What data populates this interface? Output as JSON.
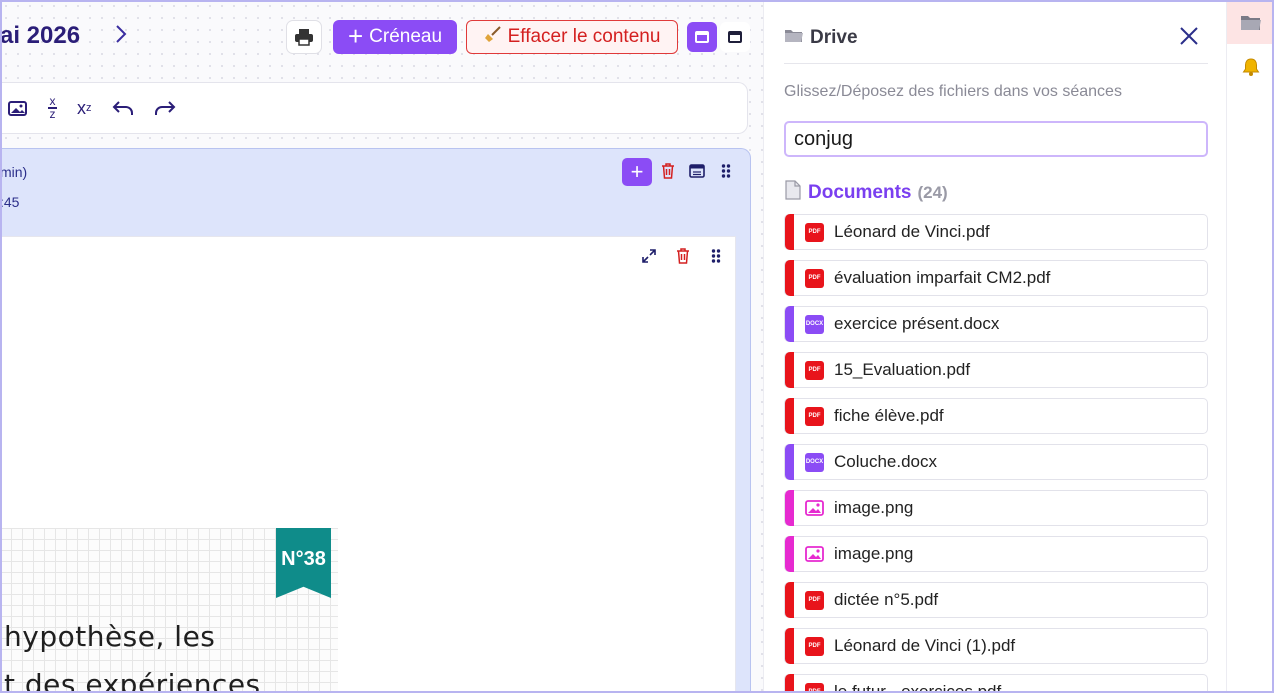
{
  "header": {
    "title": "ai 2026",
    "print_label": "",
    "add_slot_label": "Créneau",
    "clear_label": "Effacer le contenu"
  },
  "toolbar": {
    "fraction_top": "x",
    "fraction_bottom": "z",
    "superscript_base": "x",
    "superscript_exp": "z"
  },
  "session": {
    "duration": "min)",
    "time": ":45"
  },
  "document_preview": {
    "badge": "N°38",
    "line1": "hypothèse, les",
    "line2": "t des expériences"
  },
  "drive": {
    "title": "Drive",
    "hint": "Glissez/Déposez des fichiers dans vos séances",
    "search_value": "conjug",
    "documents_label": "Documents",
    "documents_count": "(24)",
    "colors": {
      "pdf": "#e8141b",
      "docx": "#8b4cf5",
      "image": "#e62ad0"
    },
    "files": [
      {
        "name": "Léonard de Vinci.pdf",
        "type": "pdf"
      },
      {
        "name": "évaluation imparfait CM2.pdf",
        "type": "pdf"
      },
      {
        "name": "exercice présent.docx",
        "type": "docx"
      },
      {
        "name": "15_Evaluation.pdf",
        "type": "pdf"
      },
      {
        "name": "fiche élève.pdf",
        "type": "pdf"
      },
      {
        "name": "Coluche.docx",
        "type": "docx"
      },
      {
        "name": "image.png",
        "type": "image"
      },
      {
        "name": "image.png",
        "type": "image"
      },
      {
        "name": "dictée n°5.pdf",
        "type": "pdf"
      },
      {
        "name": "Léonard de Vinci (1).pdf",
        "type": "pdf"
      },
      {
        "name": "le futur - exercices.pdf",
        "type": "pdf"
      }
    ]
  }
}
